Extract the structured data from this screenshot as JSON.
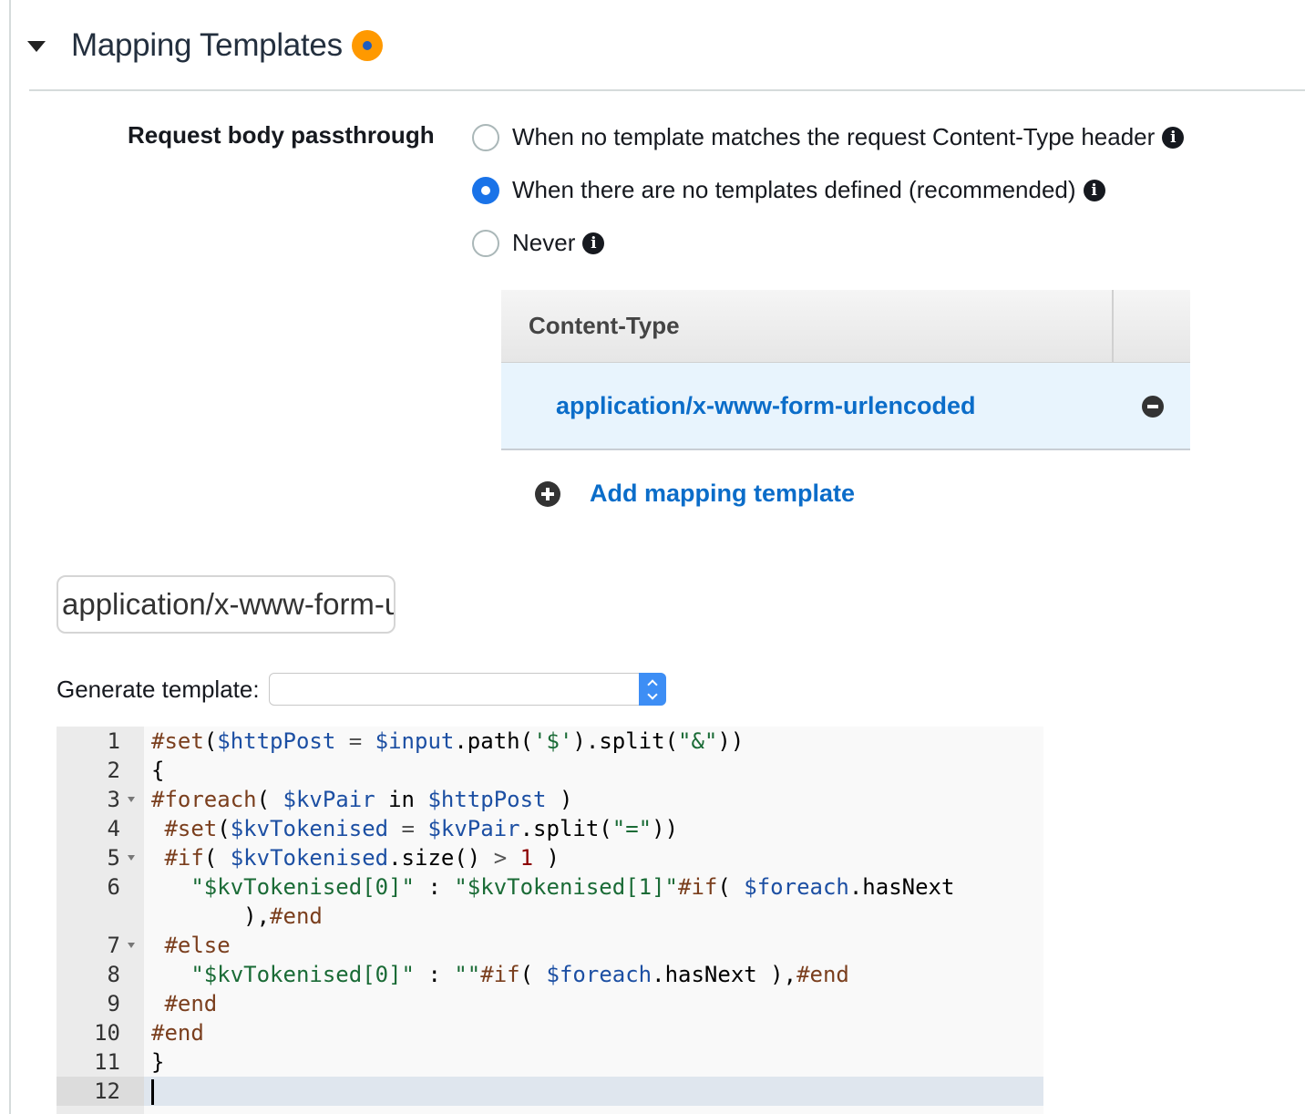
{
  "section": {
    "title": "Mapping Templates"
  },
  "passthrough": {
    "label": "Request body passthrough",
    "options": [
      {
        "label": "When no template matches the request Content-Type header",
        "checked": false
      },
      {
        "label": "When there are no templates defined (recommended)",
        "checked": true
      },
      {
        "label": "Never",
        "checked": false
      }
    ]
  },
  "content_type_table": {
    "header": "Content-Type",
    "rows": [
      "application/x-www-form-urlencoded"
    ]
  },
  "add_template": {
    "label": "Add mapping template"
  },
  "content_type_input": {
    "value": "application/x-www-form-urlencoded"
  },
  "generate_template": {
    "label": "Generate template:",
    "selected": ""
  },
  "editor": {
    "active_line": 12,
    "line_numbers": [
      "1",
      "2",
      "3",
      "4",
      "5",
      "6",
      "",
      "7",
      "8",
      "9",
      "10",
      "11",
      "12"
    ],
    "lines": [
      "#set($httpPost = $input.path('$').split(\"&\"))",
      "{",
      "#foreach( $kvPair in $httpPost )",
      " #set($kvTokenised = $kvPair.split(\"=\"))",
      " #if( $kvTokenised.size() > 1 )",
      "   \"$kvTokenised[0]\" : \"$kvTokenised[1]\"#if( $foreach.hasNext",
      "       ),#end",
      " #else",
      "   \"$kvTokenised[0]\" : \"\"#if( $foreach.hasNext ),#end",
      " #end",
      "#end",
      "}",
      ""
    ]
  },
  "colors": {
    "accent_blue": "#0b6dc9",
    "radio_checked": "#1a73e8",
    "badge_orange": "#ff9900",
    "row_highlight": "#e8f4fd"
  }
}
